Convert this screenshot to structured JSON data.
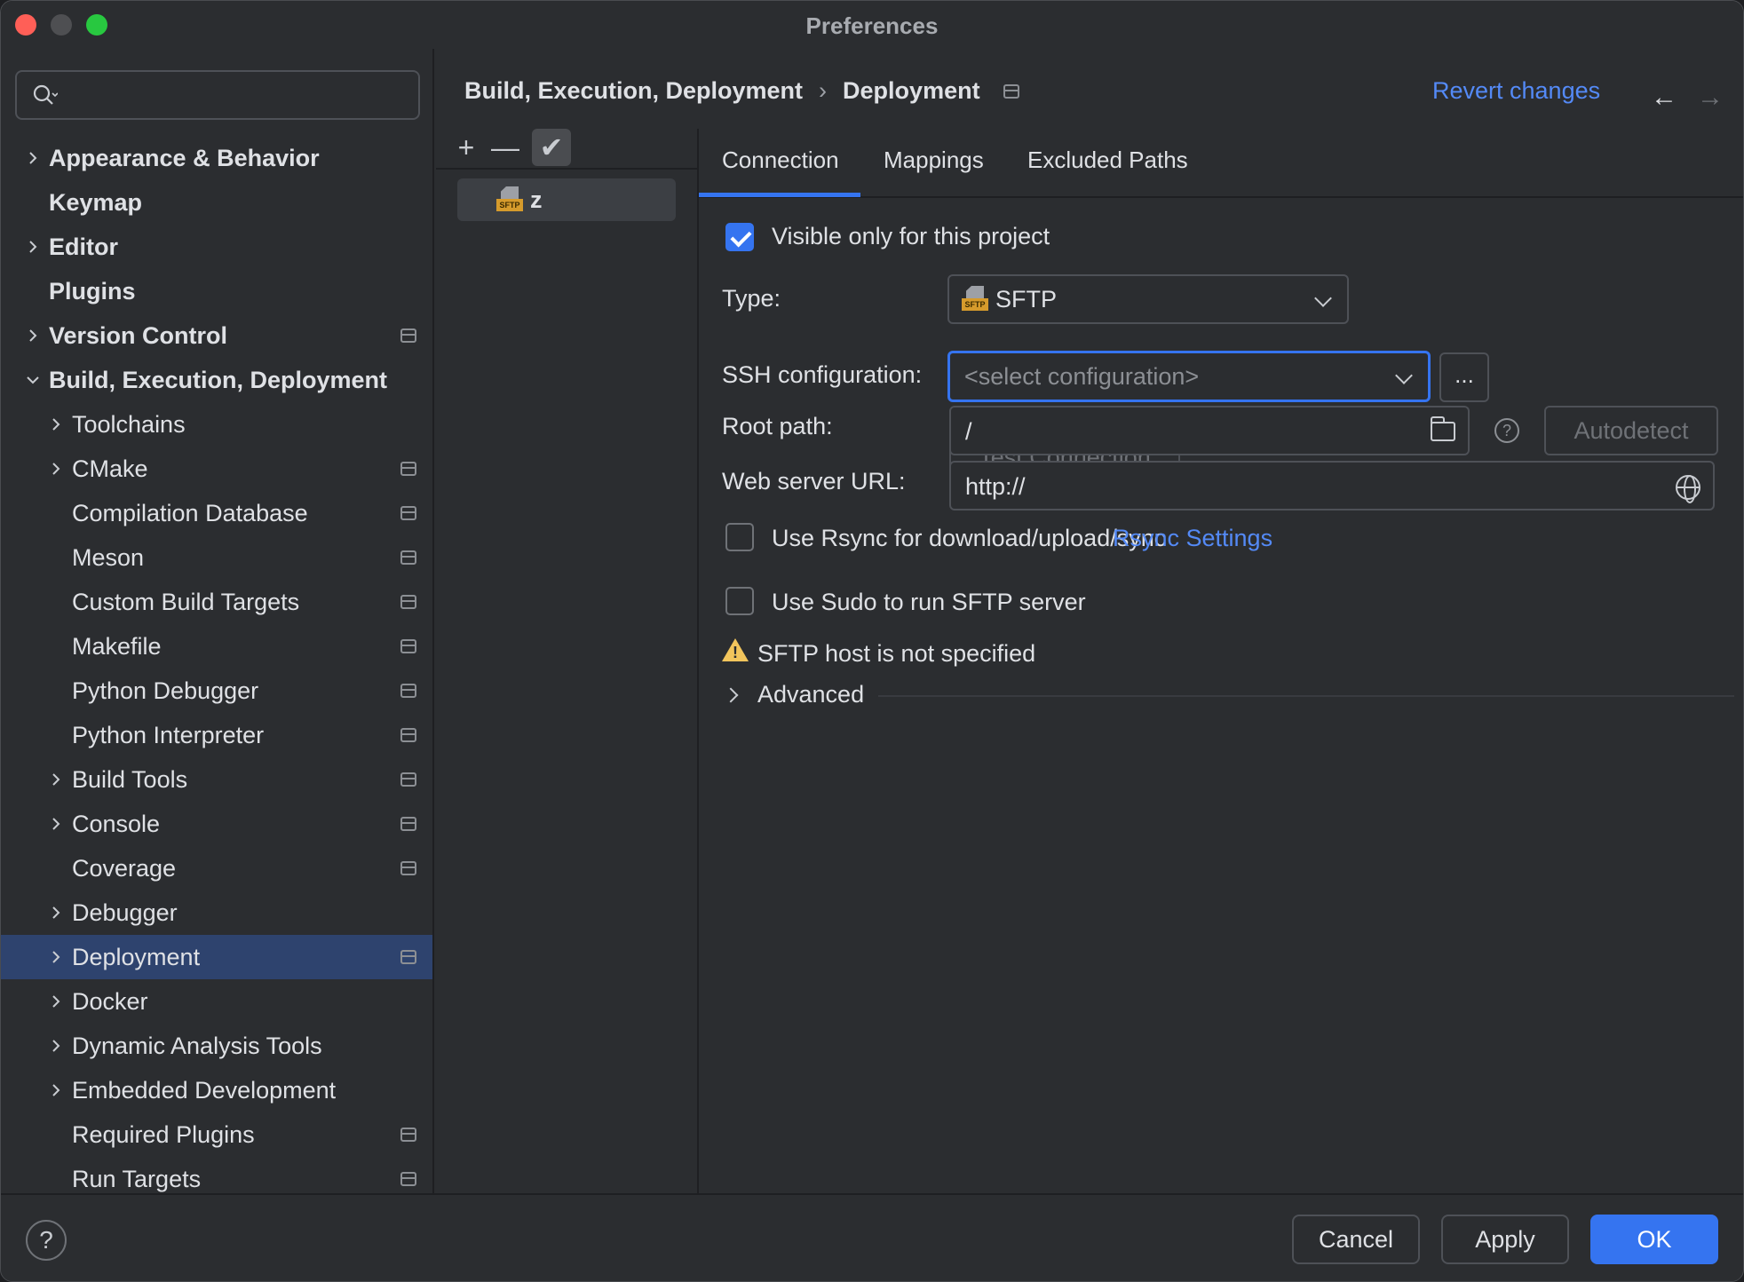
{
  "window": {
    "title": "Preferences"
  },
  "search": {
    "placeholder": "",
    "icon": "search-icon"
  },
  "sidebar": {
    "items": [
      {
        "label": "Appearance & Behavior",
        "level": 0,
        "expandable": true,
        "expanded": false,
        "project_scope": false
      },
      {
        "label": "Keymap",
        "level": 0,
        "expandable": false,
        "project_scope": false
      },
      {
        "label": "Editor",
        "level": 0,
        "expandable": true,
        "expanded": false,
        "project_scope": false
      },
      {
        "label": "Plugins",
        "level": 0,
        "expandable": false,
        "project_scope": false
      },
      {
        "label": "Version Control",
        "level": 0,
        "expandable": true,
        "expanded": false,
        "project_scope": true
      },
      {
        "label": "Build, Execution, Deployment",
        "level": 0,
        "expandable": true,
        "expanded": true,
        "project_scope": false
      },
      {
        "label": "Toolchains",
        "level": 1,
        "expandable": true,
        "project_scope": false
      },
      {
        "label": "CMake",
        "level": 1,
        "expandable": true,
        "project_scope": true
      },
      {
        "label": "Compilation Database",
        "level": 1,
        "expandable": false,
        "project_scope": true
      },
      {
        "label": "Meson",
        "level": 1,
        "expandable": false,
        "project_scope": true
      },
      {
        "label": "Custom Build Targets",
        "level": 1,
        "expandable": false,
        "project_scope": true
      },
      {
        "label": "Makefile",
        "level": 1,
        "expandable": false,
        "project_scope": true
      },
      {
        "label": "Python Debugger",
        "level": 1,
        "expandable": false,
        "project_scope": true
      },
      {
        "label": "Python Interpreter",
        "level": 1,
        "expandable": false,
        "project_scope": true
      },
      {
        "label": "Build Tools",
        "level": 1,
        "expandable": true,
        "project_scope": true
      },
      {
        "label": "Console",
        "level": 1,
        "expandable": true,
        "project_scope": true
      },
      {
        "label": "Coverage",
        "level": 1,
        "expandable": false,
        "project_scope": true
      },
      {
        "label": "Debugger",
        "level": 1,
        "expandable": true,
        "project_scope": false
      },
      {
        "label": "Deployment",
        "level": 1,
        "expandable": true,
        "project_scope": true,
        "selected": true
      },
      {
        "label": "Docker",
        "level": 1,
        "expandable": true,
        "project_scope": false
      },
      {
        "label": "Dynamic Analysis Tools",
        "level": 1,
        "expandable": true,
        "project_scope": false
      },
      {
        "label": "Embedded Development",
        "level": 1,
        "expandable": true,
        "project_scope": false
      },
      {
        "label": "Required Plugins",
        "level": 1,
        "expandable": false,
        "project_scope": true
      },
      {
        "label": "Run Targets",
        "level": 1,
        "expandable": false,
        "project_scope": true
      }
    ]
  },
  "header": {
    "breadcrumb": [
      "Build, Execution, Deployment",
      "Deployment"
    ],
    "breadcrumb_separator": "›",
    "revert_label": "Revert changes",
    "back_glyph": "←",
    "forward_glyph": "→"
  },
  "servers": {
    "toolbar": {
      "add": "+",
      "remove": "—",
      "default": "✔"
    },
    "items": [
      {
        "name": "z",
        "type_badge": "SFTP"
      }
    ]
  },
  "tabs": [
    "Connection",
    "Mappings",
    "Excluded Paths"
  ],
  "connection": {
    "visible_only_label": "Visible only for this project",
    "visible_only_checked": true,
    "type_label": "Type:",
    "type_value": "SFTP",
    "type_badge": "SFTP",
    "ssh_label": "SSH configuration:",
    "ssh_placeholder": "<select configuration>",
    "ssh_more": "...",
    "test_connection": "Test Connection",
    "root_path_label": "Root path:",
    "root_path_value": "/",
    "help_glyph": "?",
    "autodetect": "Autodetect",
    "web_url_label": "Web server URL:",
    "web_url_value": "http://",
    "rsync_label": "Use Rsync for download/upload/sync",
    "rsync_checked": false,
    "rsync_settings": "Rsync Settings",
    "sudo_label": "Use Sudo to run SFTP server",
    "sudo_checked": false,
    "warning_glyph": "!",
    "warning": "SFTP host is not specified",
    "advanced": "Advanced"
  },
  "footer": {
    "help": "?",
    "cancel": "Cancel",
    "apply": "Apply",
    "ok": "OK"
  },
  "colors": {
    "accent": "#3574f0",
    "link": "#548af7",
    "selection": "#2e436e",
    "warning": "#f2c55c",
    "close": "#ff5f57",
    "maximize": "#28c840"
  }
}
